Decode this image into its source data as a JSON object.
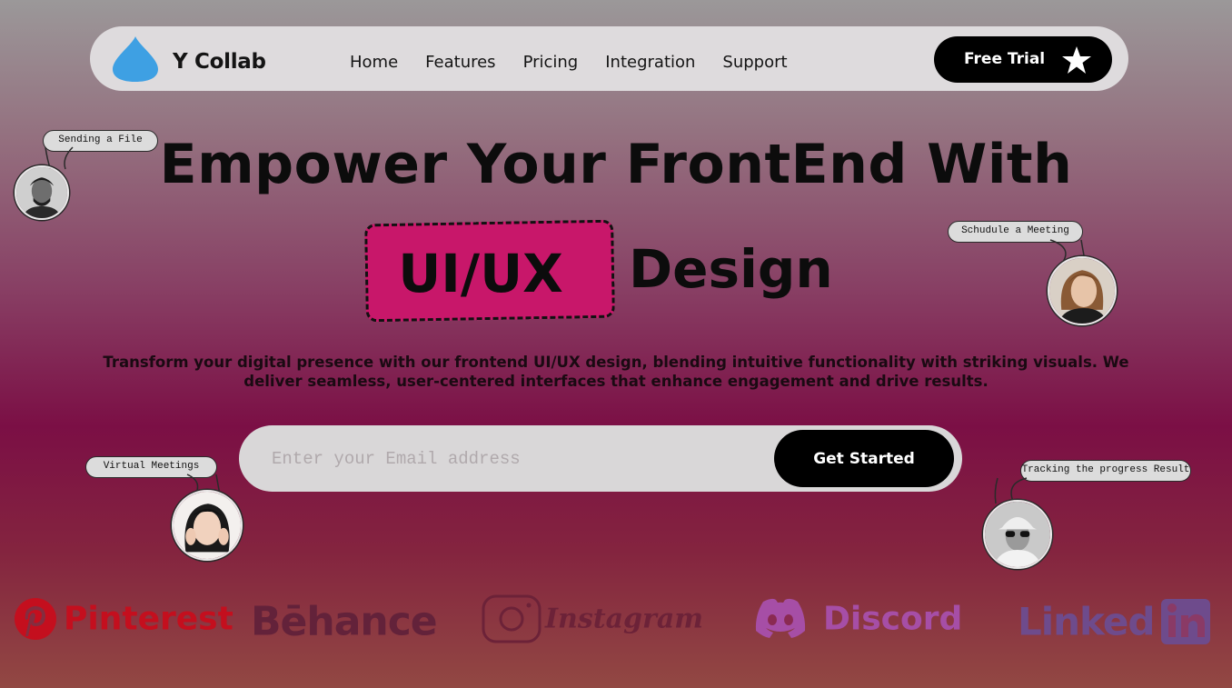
{
  "nav": {
    "brand": "Y Collab",
    "links": [
      "Home",
      "Features",
      "Pricing",
      "Integration",
      "Support"
    ],
    "cta": "Free Trial"
  },
  "hero": {
    "line1": "Empower Your FrontEnd With",
    "highlight": "UI/UX",
    "line2_rest": "Design",
    "subtext": "Transform your digital presence with our frontend UI/UX design, blending intuitive functionality with striking visuals. We deliver seamless, user-centered interfaces that enhance engagement and drive results."
  },
  "form": {
    "email_placeholder": "Enter your Email address",
    "submit_label": "Get Started"
  },
  "bubbles": {
    "sending": "Sending a File",
    "meeting": "Schudule a Meeting",
    "virtual": "Virtual Meetings",
    "tracking": "Tracking the progress Result"
  },
  "brands": {
    "pinterest": "Pinterest",
    "behance": "Bēhance",
    "instagram": "Instagram",
    "discord": "Discord",
    "linkedin": "Linked"
  },
  "colors": {
    "accent_pink": "#c8176a",
    "logo_blue": "#3ea0e3",
    "nav_bg": "#dedbdd",
    "button_bg": "#000000"
  },
  "icons": {
    "logo": "water-drop-icon",
    "trial": "star-icon"
  }
}
